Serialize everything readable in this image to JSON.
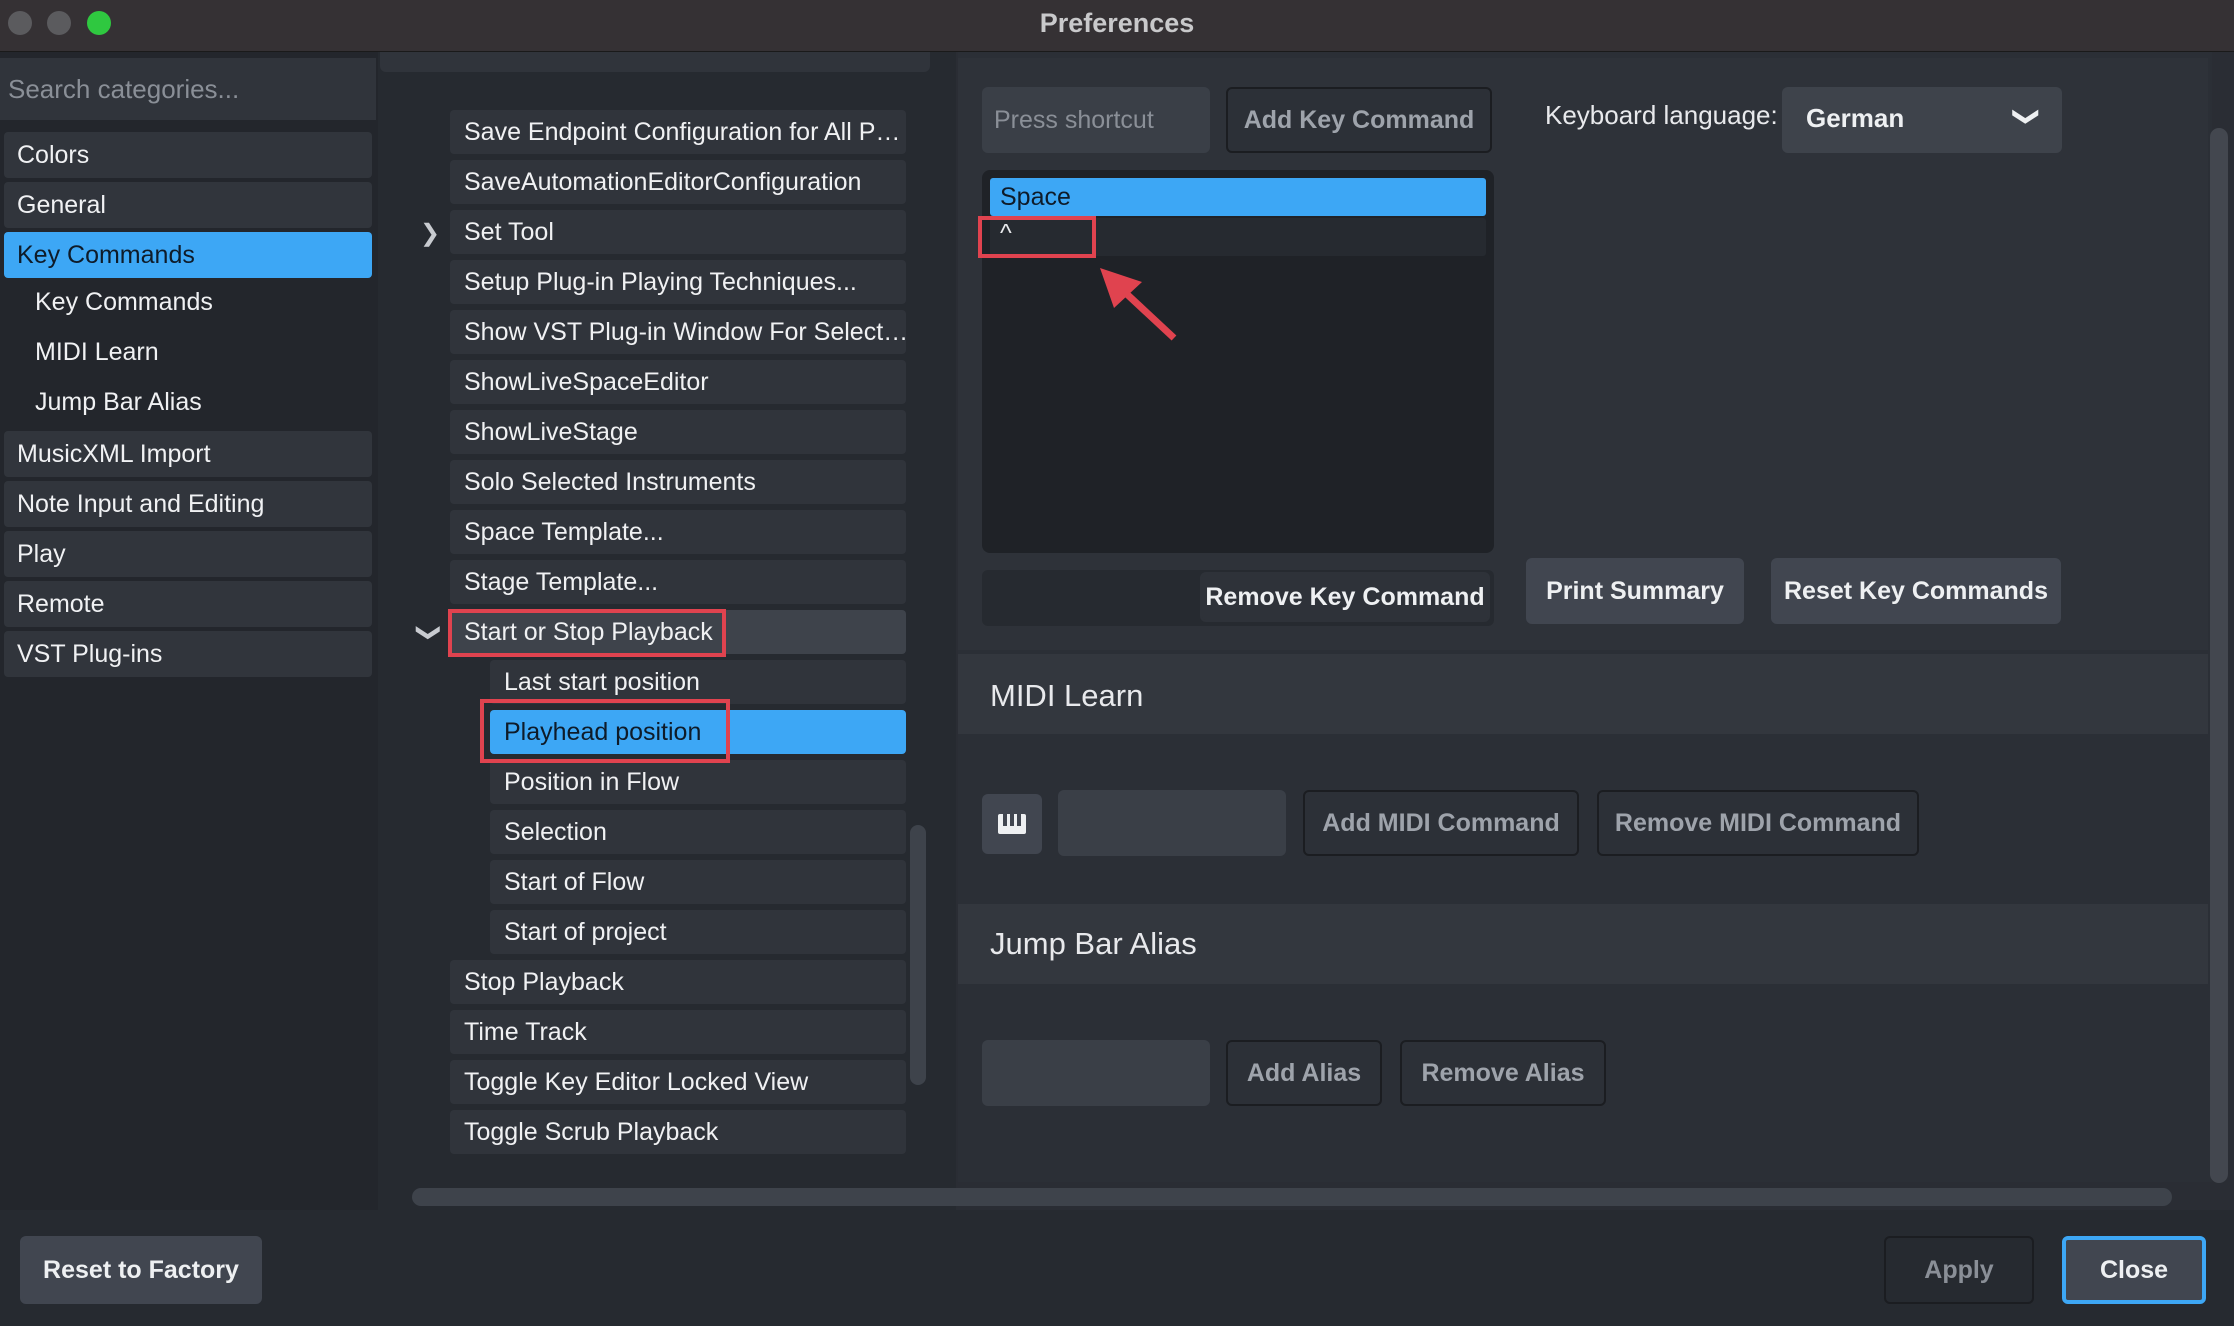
{
  "window": {
    "title": "Preferences"
  },
  "sidebar": {
    "search_placeholder": "Search categories...",
    "items": [
      {
        "label": "Colors"
      },
      {
        "label": "General"
      },
      {
        "label": "Key Commands"
      },
      {
        "label": "Key Commands"
      },
      {
        "label": "MIDI Learn"
      },
      {
        "label": "Jump Bar Alias"
      },
      {
        "label": "MusicXML Import"
      },
      {
        "label": "Note Input and Editing"
      },
      {
        "label": "Play"
      },
      {
        "label": "Remote"
      },
      {
        "label": "VST Plug-ins"
      }
    ]
  },
  "commands": [
    {
      "label": "Save Endpoint Configuration for All P…"
    },
    {
      "label": "SaveAutomationEditorConfiguration"
    },
    {
      "label": "Set Tool"
    },
    {
      "label": "Setup Plug-in Playing Techniques..."
    },
    {
      "label": "Show VST Plug-in Window For Select…"
    },
    {
      "label": "ShowLiveSpaceEditor"
    },
    {
      "label": "ShowLiveStage"
    },
    {
      "label": "Solo Selected Instruments"
    },
    {
      "label": "Space Template..."
    },
    {
      "label": "Stage Template..."
    },
    {
      "label": "Start or Stop Playback"
    },
    {
      "label": "Last start position"
    },
    {
      "label": "Playhead position"
    },
    {
      "label": "Position in Flow"
    },
    {
      "label": "Selection"
    },
    {
      "label": "Start of Flow"
    },
    {
      "label": "Start of project"
    },
    {
      "label": "Stop Playback"
    },
    {
      "label": "Time Track"
    },
    {
      "label": "Toggle Key Editor Locked View"
    },
    {
      "label": "Toggle Scrub Playback"
    }
  ],
  "key_commands": {
    "shortcut_placeholder": "Press shortcut",
    "add_label": "Add Key Command",
    "language_label": "Keyboard language:",
    "language_value": "German",
    "assigned": [
      "Space",
      "^"
    ],
    "remove_label": "Remove Key Command",
    "print_label": "Print Summary",
    "reset_label": "Reset Key Commands"
  },
  "midi_learn": {
    "title": "MIDI Learn",
    "add_label": "Add MIDI Command",
    "remove_label": "Remove MIDI Command"
  },
  "jump_bar": {
    "title": "Jump Bar Alias",
    "add_label": "Add Alias",
    "remove_label": "Remove Alias"
  },
  "footer": {
    "reset_label": "Reset to Factory",
    "apply_label": "Apply",
    "close_label": "Close"
  },
  "colors": {
    "accent": "#3da7f5",
    "highlight": "#e0434f"
  }
}
